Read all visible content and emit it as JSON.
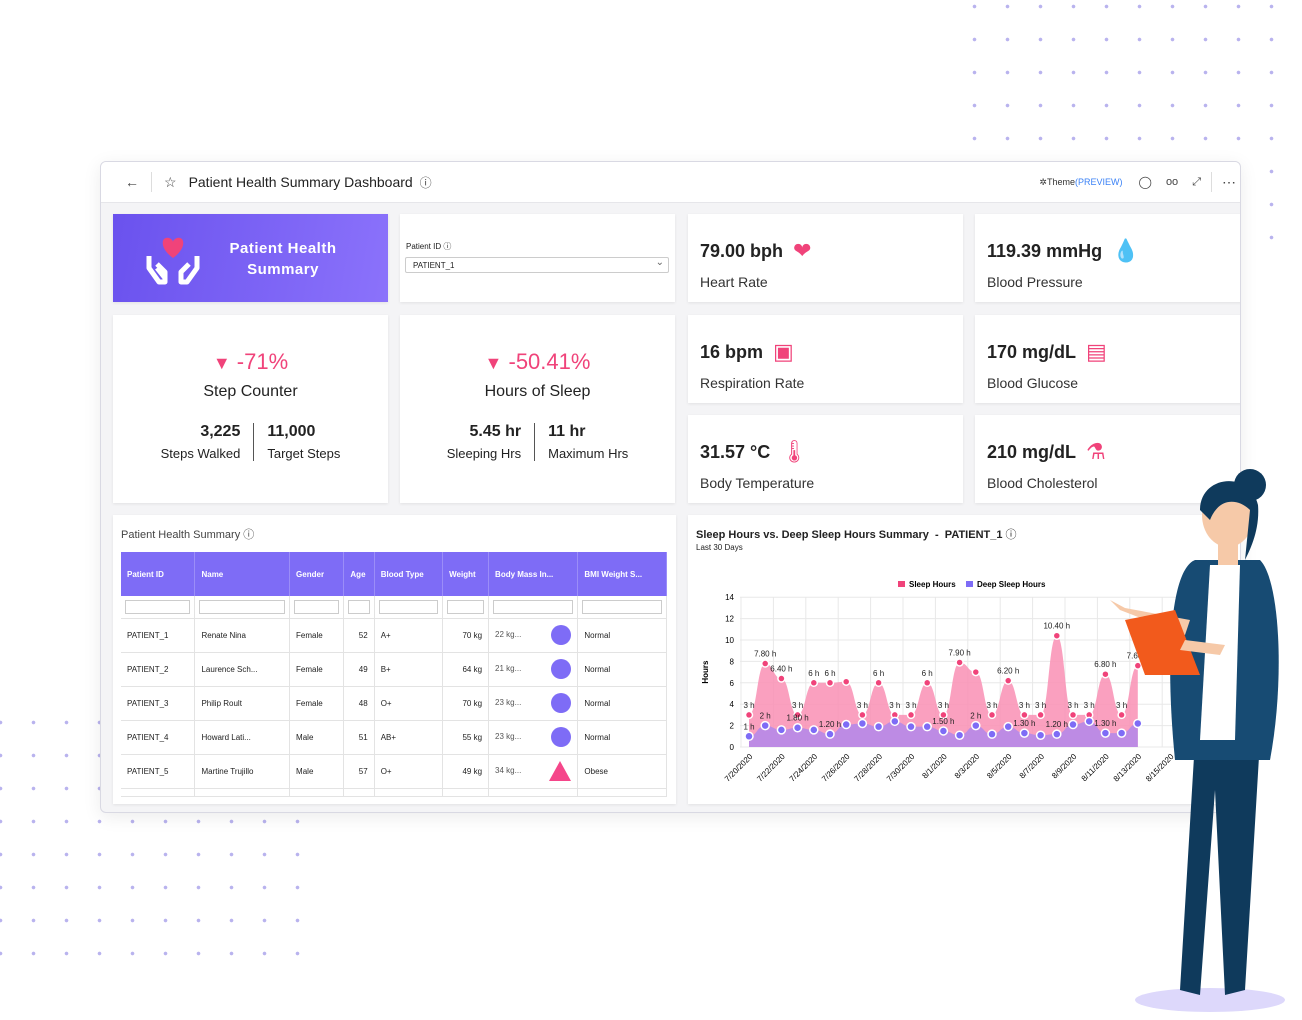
{
  "header": {
    "title": "Patient Health Summary Dashboard",
    "theme_label": "Theme",
    "theme_preview": "(PREVIEW)"
  },
  "banner": {
    "title_line1": "Patient Health",
    "title_line2": "Summary"
  },
  "patient_filter": {
    "label": "Patient ID",
    "value": "PATIENT_1"
  },
  "vitals": [
    {
      "value": "79.00 bph",
      "label": "Heart Rate",
      "icon": "heart-rate-icon"
    },
    {
      "value": "119.39 mmHg",
      "label": "Blood Pressure",
      "icon": "blood-drop-icon"
    },
    {
      "value": "16 bpm",
      "label": "Respiration Rate",
      "icon": "respiration-monitor-icon"
    },
    {
      "value": "170 mg/dL",
      "label": "Blood Glucose",
      "icon": "glucose-meter-icon"
    },
    {
      "value": "31.57 °C",
      "label": "Body Temperature",
      "icon": "thermometer-icon"
    },
    {
      "value": "210 mg/dL",
      "label": "Blood Cholesterol",
      "icon": "cholesterol-icon"
    }
  ],
  "steps": {
    "change": "-71%",
    "title": "Step Counter",
    "left_value": "3,225",
    "left_label": "Steps Walked",
    "right_value": "11,000",
    "right_label": "Target Steps"
  },
  "sleep": {
    "change": "-50.41%",
    "title": "Hours of Sleep",
    "left_value": "5.45 hr",
    "left_label": "Sleeping Hrs",
    "right_value": "11 hr",
    "right_label": "Maximum Hrs"
  },
  "table": {
    "title": "Patient Health Summary",
    "columns": [
      "Patient ID",
      "Name",
      "Gender",
      "Age",
      "Blood Type",
      "Weight",
      "Body Mass In...",
      "BMI Weight S..."
    ],
    "rows": [
      [
        "PATIENT_1",
        "Renate Nina",
        "Female",
        "52",
        "A+",
        "70 kg",
        "22 kg...",
        "Normal"
      ],
      [
        "PATIENT_2",
        "Laurence Sch...",
        "Female",
        "49",
        "B+",
        "64 kg",
        "21 kg...",
        "Normal"
      ],
      [
        "PATIENT_3",
        "Philip Roult",
        "Female",
        "48",
        "O+",
        "70 kg",
        "23 kg...",
        "Normal"
      ],
      [
        "PATIENT_4",
        "Howard Lati...",
        "Male",
        "51",
        "AB+",
        "55 kg",
        "23 kg...",
        "Normal"
      ],
      [
        "PATIENT_5",
        "Martine Trujillo",
        "Male",
        "57",
        "O+",
        "49 kg",
        "34 kg...",
        "Obese"
      ]
    ],
    "bmi_markers": [
      "circle",
      "circle",
      "circle",
      "circle",
      "triangle"
    ],
    "colors": {
      "normal": "#7e6cf6",
      "obese": "#f5468a"
    }
  },
  "chart_data": {
    "type": "area",
    "title": "Sleep Hours vs. Deep Sleep Hours Summary  -  PATIENT_1",
    "subtitle": "Last 30 Days",
    "ylabel": "Hours",
    "ylim": [
      0,
      14
    ],
    "yticks": [
      0,
      2,
      4,
      6,
      8,
      10,
      12,
      14
    ],
    "grid": true,
    "legend_position": "top",
    "x_tick_labels": [
      "7/20/2020",
      "7/22/2020",
      "7/24/2020",
      "7/26/2020",
      "7/28/2020",
      "7/30/2020",
      "8/1/2020",
      "8/3/2020",
      "8/5/2020",
      "8/7/2020",
      "8/9/2020",
      "8/11/2020",
      "8/13/2020",
      "8/15/2020"
    ],
    "x": [
      "7/20/2020",
      "7/21/2020",
      "7/22/2020",
      "7/23/2020",
      "7/24/2020",
      "7/25/2020",
      "7/26/2020",
      "7/27/2020",
      "7/28/2020",
      "7/29/2020",
      "7/30/2020",
      "7/31/2020",
      "8/1/2020",
      "8/2/2020",
      "8/3/2020",
      "8/4/2020",
      "8/5/2020",
      "8/6/2020",
      "8/7/2020",
      "8/8/2020",
      "8/9/2020",
      "8/10/2020",
      "8/11/2020",
      "8/12/2020",
      "8/13/2020"
    ],
    "series": [
      {
        "name": "Sleep Hours",
        "color": "#f98fb4",
        "marker": "#f0437a",
        "values": [
          3,
          7.8,
          6.4,
          3,
          6,
          6,
          6.1,
          3,
          6,
          3,
          3,
          6,
          3,
          7.9,
          7,
          3,
          6.2,
          3,
          3,
          10.4,
          3,
          3,
          6.8,
          3,
          7.6
        ],
        "labels": [
          "3 h",
          "7.80 h",
          "6.40 h",
          "3 h",
          "6 h",
          "6 h",
          "",
          "3 h",
          "6 h",
          "3 h",
          "3 h",
          "6 h",
          "3 h",
          "7.90 h",
          "",
          "3 h",
          "6.20 h",
          "3 h",
          "3 h",
          "10.40 h",
          "3 h",
          "3 h",
          "6.80 h",
          "3 h",
          "7.60 h"
        ]
      },
      {
        "name": "Deep Sleep Hours",
        "color": "#b98ae6",
        "marker": "#7e6cf6",
        "values": [
          1,
          2,
          1.6,
          1.8,
          1.6,
          1.2,
          2.1,
          2.2,
          1.9,
          2.4,
          1.9,
          1.9,
          1.5,
          1.1,
          2,
          1.2,
          1.9,
          1.3,
          1.1,
          1.2,
          2.1,
          2.4,
          1.3,
          1.3,
          2.2
        ],
        "labels": [
          "1 h",
          "2 h",
          "",
          "1.80 h",
          "",
          "1.20 h",
          "",
          "",
          "",
          "",
          "",
          "",
          "1.50 h",
          "",
          "2 h",
          "",
          "",
          "1.30 h",
          "",
          "1.20 h",
          "",
          "",
          "1.30 h",
          "",
          ""
        ]
      }
    ]
  }
}
